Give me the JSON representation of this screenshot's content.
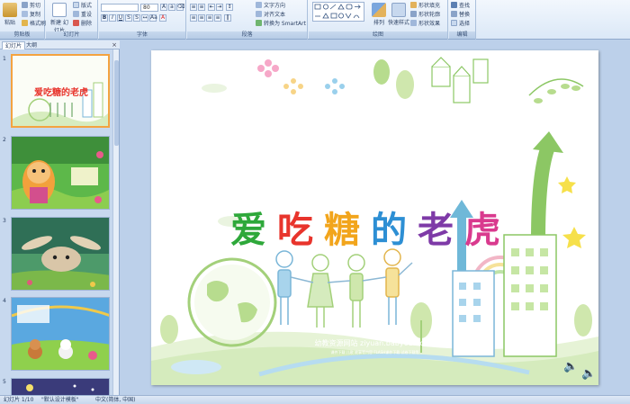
{
  "ribbon": {
    "clipboard": {
      "label": "剪贴板",
      "paste": "粘贴",
      "cut": "剪切",
      "copy": "复制",
      "format_painter": "格式刷"
    },
    "slides": {
      "label": "幻灯片",
      "new_slide": "新建\n幻灯片",
      "layout": "版式",
      "reset": "重设",
      "delete": "删除"
    },
    "font": {
      "label": "字体",
      "font_size": "80"
    },
    "paragraph": {
      "label": "段落",
      "text_direction": "文字方向",
      "align_text": "对齐文本",
      "smartart": "转换为 SmartArt"
    },
    "drawing": {
      "label": "绘图",
      "arrange": "排列",
      "quick_styles": "快速样式",
      "shape_fill": "形状填充",
      "shape_outline": "形状轮廓",
      "shape_effects": "形状效果"
    },
    "editing": {
      "label": "编辑",
      "find": "查找",
      "replace": "替换",
      "select": "选择"
    }
  },
  "side_panel": {
    "tab_slides": "幻灯片",
    "tab_outline": "大纲",
    "close_glyph": "×",
    "thumbnail_numbers": [
      "1",
      "2",
      "3",
      "4",
      "5"
    ],
    "thumbnail_title": "爱吃糖的老虎"
  },
  "slide": {
    "title_chars": [
      "爱",
      "吃",
      "糖",
      "的",
      "老",
      "虎"
    ],
    "title_colors": [
      "#2ea83a",
      "#e8342c",
      "#f2a51c",
      "#2d8fd4",
      "#7e3aa7",
      "#d93a8e"
    ],
    "footer_line1": "幼教资源网站  ziyuan.baby611.com",
    "footer_line2": "课件下载  儿歌  故事等内容  FLASH课件下载  试卷下载等"
  },
  "status_bar": {
    "slide_info": "幻灯片 1/10",
    "theme": "\"默认设计模板\"",
    "language": "中文(简体, 中国)"
  }
}
